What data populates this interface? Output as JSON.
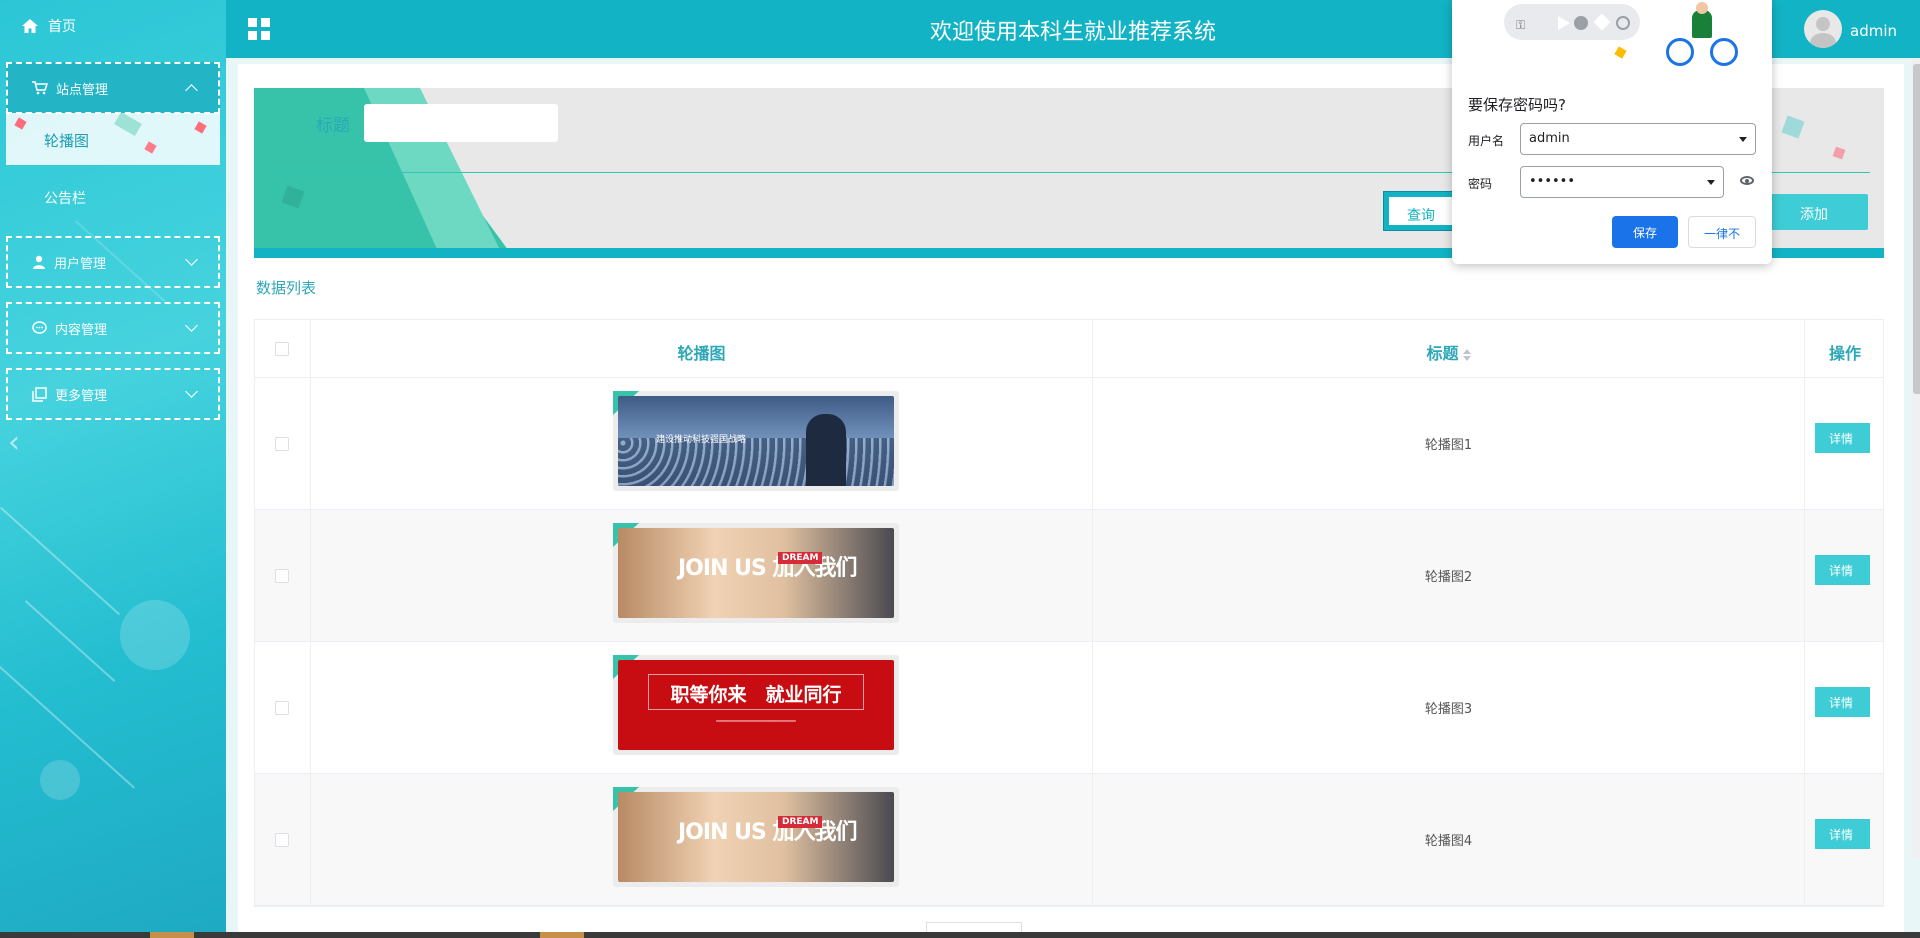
{
  "header": {
    "title": "欢迎使用本科生就业推荐系统",
    "username": "admin"
  },
  "sidebar": {
    "home": "首页",
    "groups": [
      {
        "label": "站点管理",
        "open": true,
        "children": [
          "轮播图",
          "公告栏"
        ]
      },
      {
        "label": "用户管理",
        "open": false
      },
      {
        "label": "内容管理",
        "open": false
      },
      {
        "label": "更多管理",
        "open": false
      }
    ]
  },
  "search": {
    "label": "标题",
    "value": "",
    "query_button": "查询",
    "add_button": "添加"
  },
  "list_title": "数据列表",
  "table": {
    "columns": [
      "轮播图",
      "标题",
      "操作"
    ],
    "rows": [
      {
        "title": "轮播图1",
        "image_text": "建设推动科技强国战略",
        "detail_button": "详情"
      },
      {
        "title": "轮播图2",
        "image_text": "JOIN US 加入我们",
        "image_tag": "DREAM",
        "detail_button": "详情"
      },
      {
        "title": "轮播图3",
        "image_text": "职等你来　就业同行",
        "detail_button": "详情"
      },
      {
        "title": "轮播图4",
        "image_text": "JOIN US 加入我们",
        "image_tag": "DREAM",
        "detail_button": "详情"
      }
    ]
  },
  "password_prompt": {
    "question": "要保存密码吗?",
    "username_label": "用户名",
    "username_value": "admin",
    "password_label": "密码",
    "password_value": "••••••",
    "save_button": "保存",
    "never_button": "一律不"
  },
  "colors": {
    "accent": "#12b3c4",
    "sidebar": "#2bc6d6",
    "button": "#3ecdd6",
    "chrome_blue": "#1a73e8"
  }
}
